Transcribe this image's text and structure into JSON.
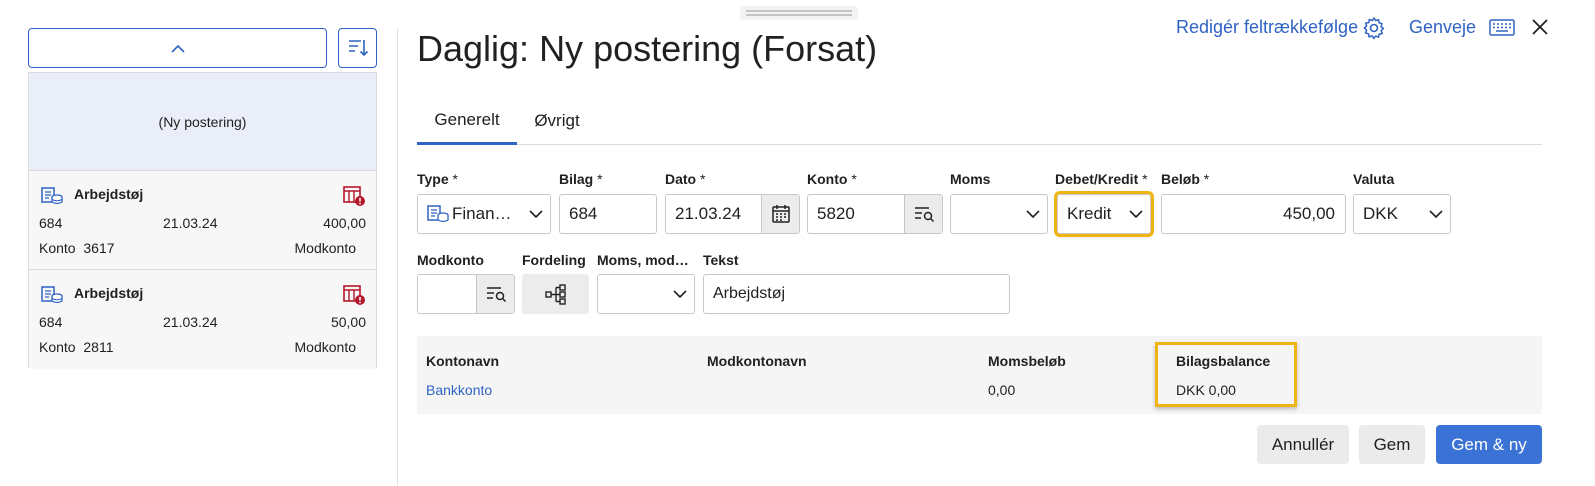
{
  "header": {
    "title": "Daglig: Ny postering (Forsat)",
    "edit_field_order": "Redigér feltrækkefølge",
    "shortcuts": "Genveje"
  },
  "tabs": [
    {
      "label": "Generelt",
      "active": true
    },
    {
      "label": "Øvrigt",
      "active": false
    }
  ],
  "list": {
    "new_entry_label": "(Ny postering)",
    "entries": [
      {
        "title": "Arbejdstøj",
        "bilag": "684",
        "date": "21.03.24",
        "amount": "400,00",
        "konto_label": "Konto",
        "konto": "3617",
        "modkonto_label": "Modkonto"
      },
      {
        "title": "Arbejdstøj",
        "bilag": "684",
        "date": "21.03.24",
        "amount": "50,00",
        "konto_label": "Konto",
        "konto": "2811",
        "modkonto_label": "Modkonto"
      }
    ]
  },
  "form": {
    "type": {
      "label": "Type",
      "value": "Finan…"
    },
    "bilag": {
      "label": "Bilag",
      "value": "684"
    },
    "dato": {
      "label": "Dato",
      "value": "21.03.24"
    },
    "konto": {
      "label": "Konto",
      "value": "5820"
    },
    "moms": {
      "label": "Moms",
      "value": ""
    },
    "debet_kredit": {
      "label": "Debet/Kredit",
      "value": "Kredit"
    },
    "belob": {
      "label": "Beløb",
      "value": "450,00"
    },
    "valuta": {
      "label": "Valuta",
      "value": "DKK"
    },
    "modkonto": {
      "label": "Modkonto",
      "value": ""
    },
    "fordeling": {
      "label": "Fordeling"
    },
    "moms_mod": {
      "label": "Moms, mod…",
      "value": ""
    },
    "tekst": {
      "label": "Tekst",
      "value": "Arbejdstøj"
    },
    "required_mark": "*"
  },
  "info_table": {
    "headers": [
      "Kontonavn",
      "Modkontonavn",
      "Momsbeløb",
      "Bilagsbalance"
    ],
    "values": [
      "Bankkonto",
      "",
      "0,00",
      "DKK 0,00"
    ]
  },
  "buttons": {
    "cancel": "Annullér",
    "save": "Gem",
    "save_new": "Gem & ny"
  },
  "colors": {
    "accent": "#2f63c4",
    "highlight": "#f0b413",
    "warning": "#b5172b",
    "primary_button": "#3b72d6"
  }
}
